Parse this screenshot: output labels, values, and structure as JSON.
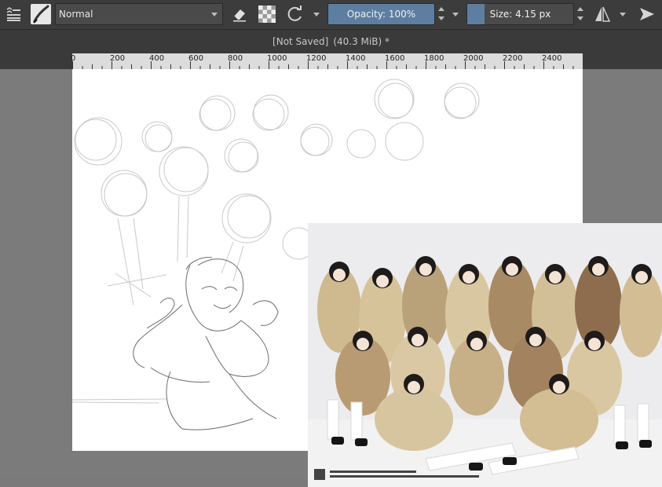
{
  "toolbar": {
    "blend_mode": "Normal",
    "opacity_label": "Opacity: 100%",
    "opacity_value": 1.0,
    "size_label": "Size: 4.15 px",
    "icons": [
      "menu-icon",
      "brush-preset-icon",
      "eraser-icon",
      "alpha-lock-icon",
      "reload-icon",
      "mirror-icon",
      "pin-icon"
    ]
  },
  "document": {
    "name": "[Not Saved]",
    "size": "(40.3 MiB) *"
  },
  "ruler": {
    "labels": [
      "0",
      "200",
      "400",
      "600",
      "800",
      "1000",
      "1200",
      "1400",
      "1600",
      "1800",
      "2000",
      "2200",
      "2400"
    ]
  },
  "colors": {
    "toolbar_bg": "#3c3c3c",
    "slider_fill": "#5d7ea0",
    "workspace_bg": "#7b7b7b",
    "canvas_bg": "#ffffff"
  }
}
